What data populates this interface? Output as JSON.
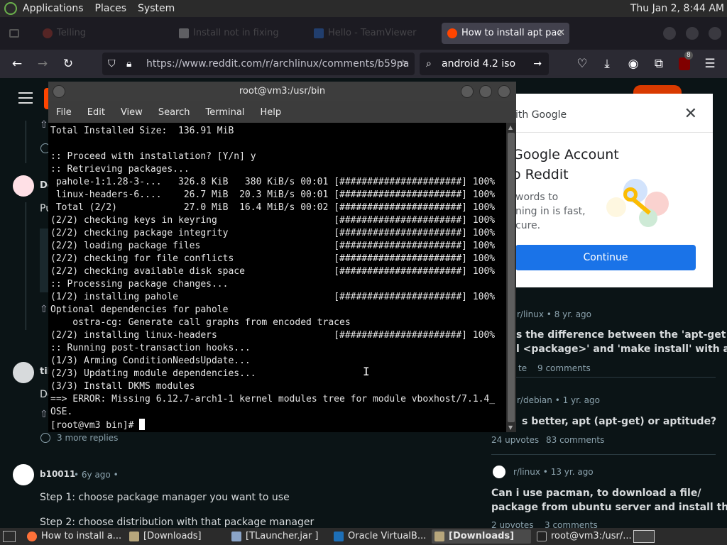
{
  "top_panel": {
    "menus": [
      "Applications",
      "Places",
      "System"
    ],
    "clock": "Thu Jan  2,  8:44 AM"
  },
  "browser": {
    "tabs": [
      {
        "label": "Telling",
        "active": false
      },
      {
        "label": "Install not in fixing",
        "active": false
      },
      {
        "label": "Hello - TeamViewer",
        "active": false
      },
      {
        "label": "How to install apt pac",
        "active": true
      }
    ],
    "url": "https://www.reddit.com/r/archlinux/comments/b59pa",
    "search_value": "android 4.2 iso",
    "extension_badge": "8"
  },
  "reddit_page": {
    "comment1_author": "De",
    "comment1_line": "Pu",
    "comment2_author": "tib",
    "comment2_line": "De",
    "more_replies": "3 more replies",
    "comment3_author": "b10011",
    "comment3_age": "• 6y ago •",
    "step1": "Step 1: choose package manager you want to use",
    "step2": "Step 2: choose distribution with that package manager",
    "sidebar": [
      {
        "community": "r/linux",
        "age": "• 8 yr. ago",
        "title": "s the difference between the 'apt-get\nl <package>' and 'make install' with a...",
        "votes": "te",
        "comments": "9 comments"
      },
      {
        "community": "r/debian",
        "age": "• 1 yr. ago",
        "title": "s better, apt (apt-get) or aptitude?",
        "votes": "24 upvotes",
        "comments": "83 comments"
      },
      {
        "community": "r/linux",
        "age": "• 13 yr. ago",
        "title": "Can i use pacman, to download a file/\npackage from ubuntu server and install the...",
        "votes": "2 upvotes",
        "comments": "3 comments"
      }
    ]
  },
  "google_popup": {
    "title": "ith Google",
    "heading_line1": "Google Account",
    "heading_line2": "o Reddit",
    "body_line1": "words to",
    "body_line2": "ning in is fast,",
    "body_line3": "cure.",
    "button": "Continue"
  },
  "terminal": {
    "title": "root@vm3:/usr/bin",
    "menu": [
      "File",
      "Edit",
      "View",
      "Search",
      "Terminal",
      "Help"
    ],
    "lines": [
      "Total Installed Size:  136.91 MiB",
      "",
      ":: Proceed with installation? [Y/n] y",
      ":: Retrieving packages...",
      " pahole-1:1.28-3-...   326.8 KiB   380 KiB/s 00:01 [######################] 100%",
      " linux-headers-6....    26.7 MiB  20.3 MiB/s 00:01 [######################] 100%",
      " Total (2/2)            27.0 MiB  16.4 MiB/s 00:02 [######################] 100%",
      "(2/2) checking keys in keyring                     [######################] 100%",
      "(2/2) checking package integrity                   [######################] 100%",
      "(2/2) loading package files                        [######################] 100%",
      "(2/2) checking for file conflicts                  [######################] 100%",
      "(2/2) checking available disk space                [######################] 100%",
      ":: Processing package changes...",
      "(1/2) installing pahole                            [######################] 100%",
      "Optional dependencies for pahole",
      "    ostra-cg: Generate call graphs from encoded traces",
      "(2/2) installing linux-headers                     [######################] 100%",
      ":: Running post-transaction hooks...",
      "(1/3) Arming ConditionNeedsUpdate...",
      "(2/3) Updating module dependencies...",
      "(3/3) Install DKMS modules",
      "==> ERROR: Missing 6.12.7-arch1-1 kernel modules tree for module vboxhost/7.1.4_",
      "OSE."
    ],
    "prompt": "[root@vm3 bin]# "
  },
  "taskbar": {
    "items": [
      {
        "label": "How to install a...",
        "active": false
      },
      {
        "label": "[Downloads]",
        "active": false
      },
      {
        "label": "[TLauncher.jar ]",
        "active": false
      },
      {
        "label": "Oracle VirtualB...",
        "active": false
      },
      {
        "label": "[Downloads]",
        "active": true
      },
      {
        "label": "root@vm3:/usr/...",
        "active": false
      }
    ]
  },
  "colors": {
    "terminal_bg": "#000000",
    "terminal_fg": "#e5e5e5",
    "reddit_bg": "#0b1416",
    "google_blue": "#1a73e8",
    "firefox_bg": "#1c1b22"
  }
}
